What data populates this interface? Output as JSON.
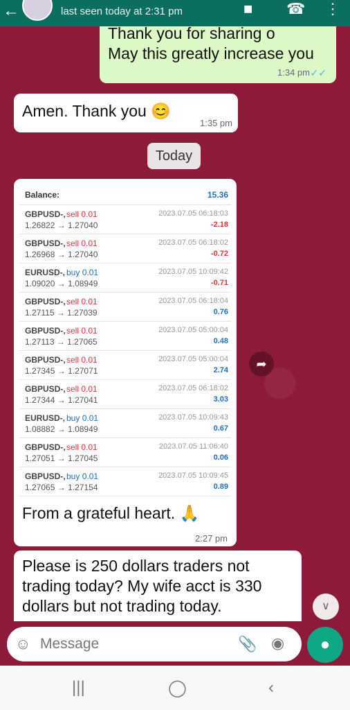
{
  "header": {
    "status": "last seen today at 2:31 pm",
    "icons": [
      "back-arrow-icon",
      "video-call-icon",
      "phone-icon",
      "more-options-icon"
    ]
  },
  "messages": [
    {
      "type": "outgoing",
      "lines": [
        "Thank you for sharing o",
        "May this greatly increase you"
      ],
      "time": "1:34 pm",
      "ticks": "✓✓"
    },
    {
      "type": "incoming",
      "text": "Amen. Thank you 😊",
      "time": "1:35 pm"
    }
  ],
  "date_chip": "Today",
  "trade_table": {
    "balance_label": "Balance:",
    "balance_value": "15.36",
    "rows": [
      {
        "symbol": "GBPUSD-,",
        "direction": "sell",
        "lot": "0.01",
        "open": "1.26822",
        "close": "1.27040",
        "datetime": "2023.07.05 06:18:03",
        "profit": "-2.18"
      },
      {
        "symbol": "GBPUSD-,",
        "direction": "sell",
        "lot": "0.01",
        "open": "1.26968",
        "close": "1.27040",
        "datetime": "2023.07.05 06:18:02",
        "profit": "-0.72"
      },
      {
        "symbol": "EURUSD-,",
        "direction": "buy",
        "lot": "0.01",
        "open": "1.09020",
        "close": "1.08949",
        "datetime": "2023.07.05 10:09:42",
        "profit": "-0.71"
      },
      {
        "symbol": "GBPUSD-,",
        "direction": "sell",
        "lot": "0.01",
        "open": "1.27115",
        "close": "1.27039",
        "datetime": "2023.07.05 06:18:04",
        "profit": "0.76"
      },
      {
        "symbol": "GBPUSD-,",
        "direction": "sell",
        "lot": "0.01",
        "open": "1.27113",
        "close": "1.27065",
        "datetime": "2023.07.05 05:00:04",
        "profit": "0.48"
      },
      {
        "symbol": "GBPUSD-,",
        "direction": "sell",
        "lot": "0.01",
        "open": "1.27345",
        "close": "1.27071",
        "datetime": "2023.07.05 05:00:04",
        "profit": "2.74"
      },
      {
        "symbol": "GBPUSD-,",
        "direction": "sell",
        "lot": "0.01",
        "open": "1.27344",
        "close": "1.27041",
        "datetime": "2023.07.05 06:18:02",
        "profit": "3.03"
      },
      {
        "symbol": "EURUSD-,",
        "direction": "buy",
        "lot": "0.01",
        "open": "1.08882",
        "close": "1.08949",
        "datetime": "2023.07.05 10:09:43",
        "profit": "0.67"
      },
      {
        "symbol": "GBPUSD-,",
        "direction": "sell",
        "lot": "0.01",
        "open": "1.27051",
        "close": "1.27045",
        "datetime": "2023.07.05 11:06:40",
        "profit": "0.06"
      },
      {
        "symbol": "GBPUSD-,",
        "direction": "buy",
        "lot": "0.01",
        "open": "1.27065",
        "close": "1.27154",
        "datetime": "2023.07.05 10:09:45",
        "profit": "0.89"
      }
    ]
  },
  "image_caption": "From a grateful heart. 🙏",
  "image_time": "2:27 pm",
  "last_message": {
    "lines": [
      "Please is 250 dollars traders not",
      "trading today? My wife acct is 330",
      "dollars but not trading today."
    ]
  },
  "input": {
    "placeholder": "Message"
  },
  "colors": {
    "header": "#0b6e5f",
    "wallpaper": "#8e1a3a",
    "outgoing_bubble": "#dcf8c6",
    "mic_button": "#0ea884"
  }
}
